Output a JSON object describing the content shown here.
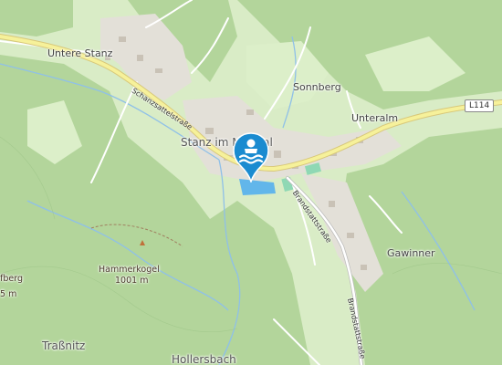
{
  "map": {
    "places": {
      "untere_stanz": "Untere Stanz",
      "sonnberg": "Sonnberg",
      "unteralm": "Unteralm",
      "stanz_im_muerztal": "Stanz im Mürztal",
      "gawinner": "Gawinner",
      "trassnitz": "Traßnitz",
      "hollersbach": "Hollersbach",
      "fberg_partial": "fberg",
      "elev_partial": "5 m"
    },
    "streets": {
      "schanzsattelstrasse": "Schanzsattelstraße",
      "brandstattstrasse": "Brandstattstraße",
      "brandstattstrasse_2": "Brandstattstraße"
    },
    "road_shield": "L114",
    "peak": {
      "name": "Hammerkogel",
      "elevation": "1001 m"
    },
    "marker": {
      "icon": "swimming-icon",
      "color": "#1a8bd0"
    },
    "colors": {
      "forest": "#b3d59b",
      "meadow": "#d9ecc6",
      "road_main": "#f6f19a",
      "water": "#62b6ea"
    }
  }
}
